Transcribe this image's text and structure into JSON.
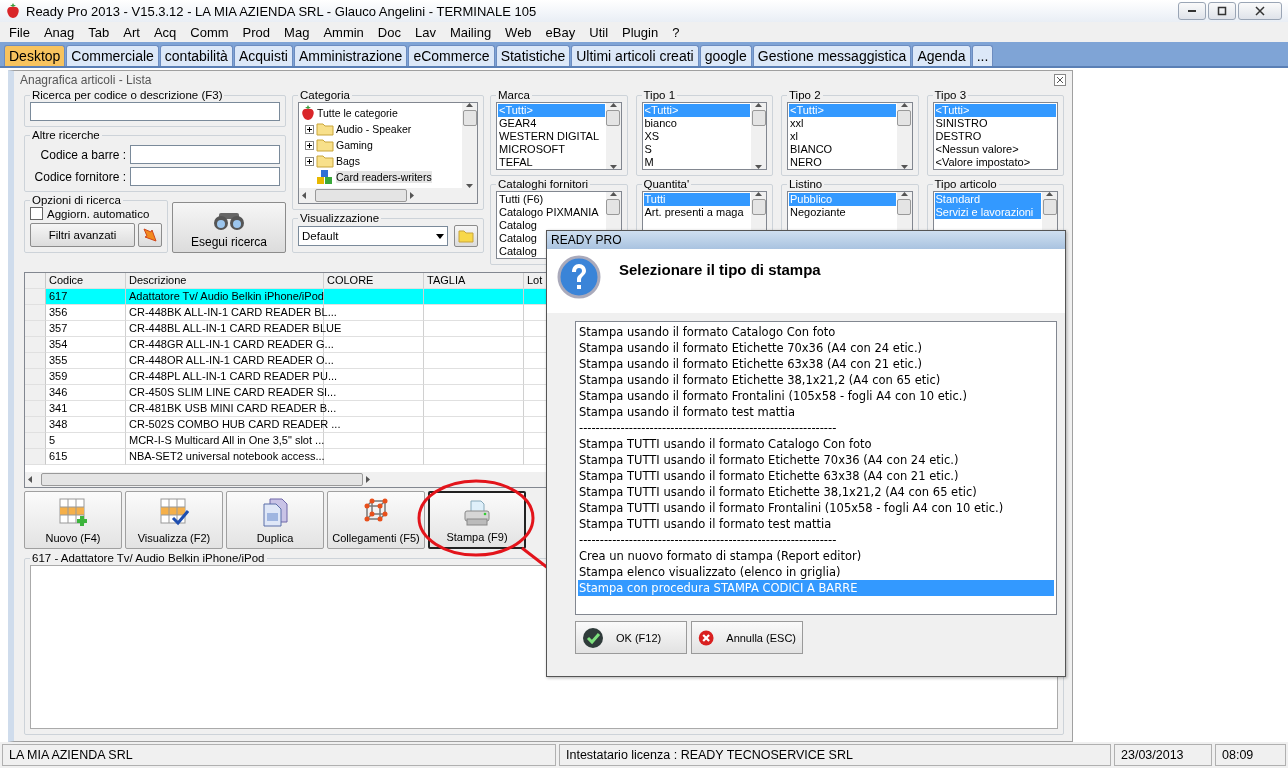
{
  "window": {
    "title": "Ready Pro 2013 - V15.3.12 - LA MIA AZIENDA SRL - Glauco Angelini - TERMINALE 105"
  },
  "menu": [
    "File",
    "Anag",
    "Tab",
    "Art",
    "Acq",
    "Comm",
    "Prod",
    "Mag",
    "Ammin",
    "Doc",
    "Lav",
    "Mailing",
    "Web",
    "eBay",
    "Util",
    "Plugin",
    "?"
  ],
  "tabs": [
    {
      "label": "Desktop",
      "selected": true
    },
    {
      "label": "Commerciale",
      "selected": false
    },
    {
      "label": "contabilità",
      "selected": false
    },
    {
      "label": "Acquisti",
      "selected": false
    },
    {
      "label": "Amministrazione",
      "selected": false
    },
    {
      "label": "eCommerce",
      "selected": false
    },
    {
      "label": "Statistiche",
      "selected": false
    },
    {
      "label": "Ultimi articoli creati",
      "selected": false
    },
    {
      "label": "google",
      "selected": false
    },
    {
      "label": "Gestione messaggistica",
      "selected": false
    },
    {
      "label": "Agenda",
      "selected": false
    },
    {
      "label": "...",
      "selected": false
    }
  ],
  "form": {
    "title": "Anagrafica articoli  - Lista",
    "search": {
      "label": "Ricerca per codice o descrizione (F3)"
    },
    "other_searches": {
      "label": "Altre ricerche",
      "fields": [
        {
          "label": "Codice a barre :"
        },
        {
          "label": "Codice fornitore :"
        }
      ]
    },
    "options": {
      "label": "Opzioni di ricerca",
      "auto_update": {
        "label": "Aggiorn. automatico",
        "checked": false
      },
      "advanced_button": "Filtri avanzati"
    },
    "search_button": "Esegui ricerca",
    "category": {
      "label": "Categoria",
      "tree": [
        {
          "label": "Tutte le categorie",
          "kind": "root",
          "selected": false,
          "children": [
            {
              "label": "Audio - Speaker",
              "kind": "folder",
              "selected": false,
              "expanded": false
            },
            {
              "label": "Gaming",
              "kind": "folder",
              "selected": false,
              "expanded": false
            },
            {
              "label": "Bags",
              "kind": "folder",
              "selected": false,
              "expanded": false
            },
            {
              "label": "Card readers-writers",
              "kind": "leaf",
              "selected": true
            }
          ]
        }
      ]
    },
    "view": {
      "label": "Visualizzazione",
      "value": "Default"
    },
    "filters": [
      {
        "label": "Marca",
        "scrollbar": true,
        "items": [
          {
            "label": "<Tutti>",
            "selected": true
          },
          {
            "label": "GEAR4",
            "selected": false
          },
          {
            "label": "WESTERN DIGITAL",
            "selected": false
          },
          {
            "label": "MICROSOFT",
            "selected": false
          },
          {
            "label": "TEFAL",
            "selected": false
          }
        ]
      },
      {
        "label": "Tipo 1",
        "scrollbar": true,
        "items": [
          {
            "label": "<Tutti>",
            "selected": true
          },
          {
            "label": "bianco",
            "selected": false
          },
          {
            "label": "XS",
            "selected": false
          },
          {
            "label": "S",
            "selected": false
          },
          {
            "label": "M",
            "selected": false
          }
        ]
      },
      {
        "label": "Tipo 2",
        "scrollbar": true,
        "items": [
          {
            "label": "<Tutti>",
            "selected": true
          },
          {
            "label": "xxl",
            "selected": false
          },
          {
            "label": "xl",
            "selected": false
          },
          {
            "label": "BIANCO",
            "selected": false
          },
          {
            "label": "NERO",
            "selected": false
          }
        ]
      },
      {
        "label": "Tipo 3",
        "scrollbar": false,
        "items": [
          {
            "label": "<Tutti>",
            "selected": true
          },
          {
            "label": "SINISTRO",
            "selected": false
          },
          {
            "label": "DESTRO",
            "selected": false
          },
          {
            "label": "<Nessun valore>",
            "selected": false
          },
          {
            "label": "<Valore impostato>",
            "selected": false
          }
        ]
      },
      {
        "label": "Cataloghi fornitori",
        "scrollbar": true,
        "items": [
          {
            "label": "Tutti (F6)",
            "selected": false
          },
          {
            "label": "Catalogo PIXMANIA",
            "selected": false
          },
          {
            "label": "Catalog",
            "selected": false
          },
          {
            "label": "Catalog",
            "selected": false
          },
          {
            "label": "Catalog",
            "selected": false
          }
        ]
      },
      {
        "label": "Quantita'",
        "scrollbar": true,
        "items": [
          {
            "label": "Tutti",
            "selected": true
          },
          {
            "label": "Art. presenti a maga",
            "selected": false
          }
        ]
      },
      {
        "label": "Listino",
        "scrollbar": true,
        "items": [
          {
            "label": "Pubblico",
            "selected": true
          },
          {
            "label": "Negoziante",
            "selected": false
          }
        ]
      },
      {
        "label": "Tipo articolo",
        "scrollbar": true,
        "items": [
          {
            "label": "Standard",
            "selected": true
          },
          {
            "label": "Servizi e lavorazioni",
            "selected": true
          }
        ]
      }
    ],
    "table": {
      "columns": [
        "Codice",
        "Descrizione",
        "COLORE",
        "TAGLIA",
        "Lot"
      ],
      "rows": [
        {
          "cells": [
            "617",
            "Adattatore Tv/ Audio Belkin iPhone/iPod"
          ],
          "selected": true
        },
        {
          "cells": [
            "356",
            "CR-448BK ALL-IN-1 CARD READER BL..."
          ],
          "selected": false
        },
        {
          "cells": [
            "357",
            "CR-448BL ALL-IN-1 CARD READER BLUE"
          ],
          "selected": false
        },
        {
          "cells": [
            "354",
            "CR-448GR ALL-IN-1 CARD READER G..."
          ],
          "selected": false
        },
        {
          "cells": [
            "355",
            "CR-448OR ALL-IN-1 CARD READER O..."
          ],
          "selected": false
        },
        {
          "cells": [
            "359",
            "CR-448PL ALL-IN-1 CARD READER PU..."
          ],
          "selected": false
        },
        {
          "cells": [
            "346",
            "CR-450S SLIM LINE CARD READER SI..."
          ],
          "selected": false
        },
        {
          "cells": [
            "341",
            "CR-481BK USB MINI CARD READER B..."
          ],
          "selected": false
        },
        {
          "cells": [
            "348",
            "CR-502S COMBO HUB CARD READER ..."
          ],
          "selected": false
        },
        {
          "cells": [
            "5",
            "MCR-I-S Multicard All in One 3,5\" slot ..."
          ],
          "selected": false
        },
        {
          "cells": [
            "615",
            "NBA-SET2 universal notebook access..."
          ],
          "selected": false
        }
      ]
    },
    "actions": [
      {
        "label": "Nuovo (F4)",
        "kind": "new",
        "selected": false
      },
      {
        "label": "Visualizza (F2)",
        "kind": "view",
        "selected": false
      },
      {
        "label": "Duplica",
        "kind": "copy",
        "selected": false
      },
      {
        "label": "Collegamenti (F5)",
        "kind": "links",
        "selected": false
      },
      {
        "label": "Stampa (F9)",
        "kind": "print",
        "selected": true
      }
    ],
    "detail": {
      "label": "617 - Adattatore Tv/ Audio Belkin iPhone/iPod"
    }
  },
  "dialog": {
    "title": "READY PRO",
    "heading": "Selezionare il tipo di stampa",
    "options": [
      {
        "label": "Stampa usando il formato Catalogo Con foto",
        "selected": false
      },
      {
        "label": "Stampa usando il formato Etichette 70x36 (A4 con 24 etic.)",
        "selected": false
      },
      {
        "label": "Stampa usando il formato Etichette 63x38 (A4 con 21 etic.)",
        "selected": false
      },
      {
        "label": "Stampa usando il formato Etichette 38,1x21,2 (A4 con 65 etic)",
        "selected": false
      },
      {
        "label": "Stampa usando il formato Frontalini (105x58 - fogli A4 con 10 etic.)",
        "selected": false
      },
      {
        "label": "Stampa usando il formato test mattia",
        "selected": false
      },
      {
        "label": "--------------------------------------------------------------",
        "selected": false
      },
      {
        "label": "Stampa TUTTI usando il formato Catalogo Con foto",
        "selected": false
      },
      {
        "label": "Stampa TUTTI usando il formato Etichette 70x36 (A4 con 24 etic.)",
        "selected": false
      },
      {
        "label": "Stampa TUTTI usando il formato Etichette 63x38 (A4 con 21 etic.)",
        "selected": false
      },
      {
        "label": "Stampa TUTTI usando il formato Etichette 38,1x21,2 (A4 con 65 etic)",
        "selected": false
      },
      {
        "label": "Stampa TUTTI usando il formato Frontalini (105x58 - fogli A4 con 10 etic.)",
        "selected": false
      },
      {
        "label": "Stampa TUTTI usando il formato test mattia",
        "selected": false
      },
      {
        "label": "--------------------------------------------------------------",
        "selected": false
      },
      {
        "label": "Crea un nuovo formato di stampa (Report editor)",
        "selected": false
      },
      {
        "label": "Stampa elenco visualizzato (elenco in griglia)",
        "selected": false
      },
      {
        "label": "Stampa con procedura STAMPA CODICI A BARRE",
        "selected": true
      }
    ],
    "buttons": [
      {
        "label": "OK (F12)",
        "kind": "ok"
      },
      {
        "label": "Annulla (ESC)",
        "kind": "cancel"
      }
    ]
  },
  "status_bar": [
    "LA MIA AZIENDA SRL",
    "Intestatario licenza : READY TECNOSERVICE SRL",
    "23/03/2013",
    "08:09"
  ]
}
